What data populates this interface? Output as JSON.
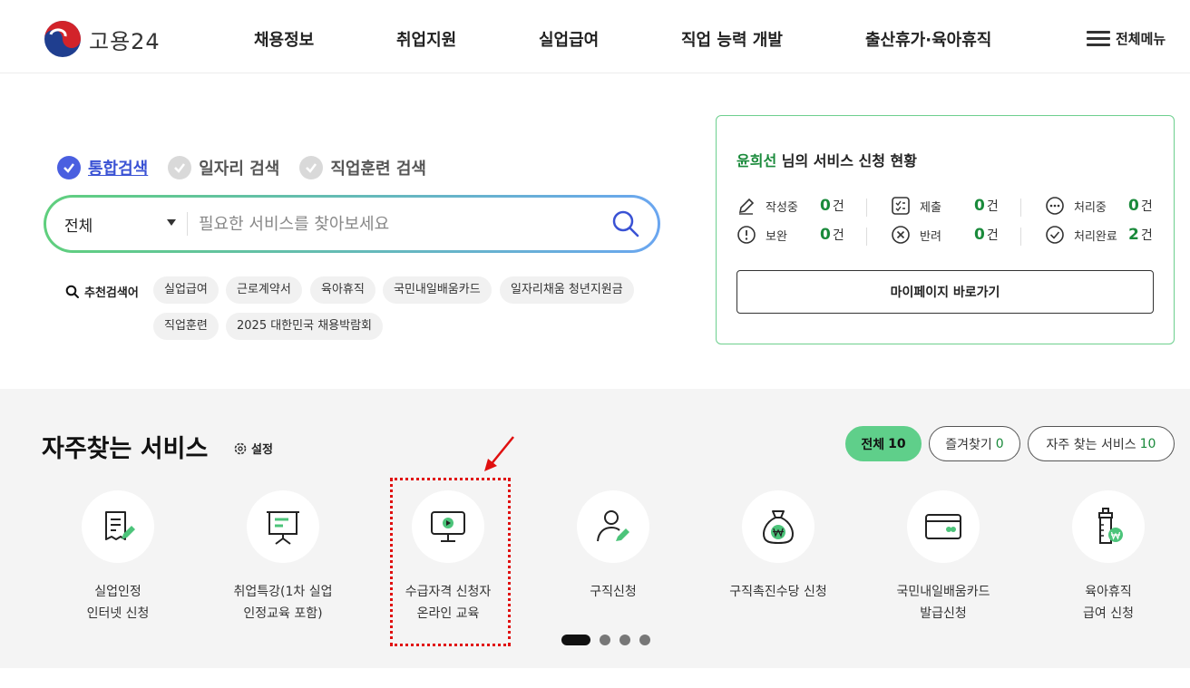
{
  "header": {
    "logo_text": "고용24",
    "nav": [
      "채용정보",
      "취업지원",
      "실업급여",
      "직업 능력 개발",
      "출산휴가·육아휴직"
    ],
    "all_menu": "전체메뉴"
  },
  "search": {
    "tabs": [
      {
        "label": "통합검색",
        "active": true
      },
      {
        "label": "일자리 검색",
        "active": false
      },
      {
        "label": "직업훈련 검색",
        "active": false
      }
    ],
    "category": "전체",
    "placeholder": "필요한 서비스를 찾아보세요",
    "recommend_label": "추천검색어",
    "keywords": [
      "실업급여",
      "근로계약서",
      "육아휴직",
      "국민내일배움카드",
      "일자리채움 청년지원금",
      "직업훈련",
      "2025 대한민국 채용박람회"
    ]
  },
  "status_card": {
    "user_name": "윤희선",
    "title_suffix": " 님의 서비스 신청 현황",
    "unit": "건",
    "stats": [
      {
        "label": "작성중",
        "count": "0",
        "icon": "pencil-icon"
      },
      {
        "label": "제출",
        "count": "0",
        "icon": "checklist-icon"
      },
      {
        "label": "처리중",
        "count": "0",
        "icon": "more-icon"
      },
      {
        "label": "보완",
        "count": "0",
        "icon": "alert-icon"
      },
      {
        "label": "반려",
        "count": "0",
        "icon": "x-circle-icon"
      },
      {
        "label": "처리완료",
        "count": "2",
        "icon": "check-circle-icon"
      }
    ],
    "mypage_button": "마이페이지 바로가기"
  },
  "favorites": {
    "title": "자주찾는 서비스",
    "settings_label": "설정",
    "filters": [
      {
        "label": "전체",
        "count": "10",
        "active": true
      },
      {
        "label": "즐겨찾기",
        "count": "0",
        "active": false
      },
      {
        "label": "자주 찾는 서비스",
        "count": "10",
        "active": false
      }
    ],
    "services": [
      {
        "label": "실업인정\n인터넷 신청",
        "icon": "document-pen-icon"
      },
      {
        "label": "취업특강(1차 실업\n인정교육 포함)",
        "icon": "presentation-board-icon"
      },
      {
        "label": "수급자격 신청자\n온라인 교육",
        "icon": "monitor-play-icon"
      },
      {
        "label": "구직신청",
        "icon": "person-pen-icon"
      },
      {
        "label": "구직촉진수당 신청",
        "icon": "money-bag-icon"
      },
      {
        "label": "국민내일배움카드\n발급신청",
        "icon": "card-icon"
      },
      {
        "label": "육아휴직\n급여 신청",
        "icon": "baby-bottle-icon"
      }
    ],
    "pages": 4,
    "current_page": 1
  },
  "colors": {
    "accent_green": "#1a8a3b",
    "chip_green": "#5fcf8a",
    "link_blue": "#3a52d4",
    "highlight_red": "#e01010"
  }
}
